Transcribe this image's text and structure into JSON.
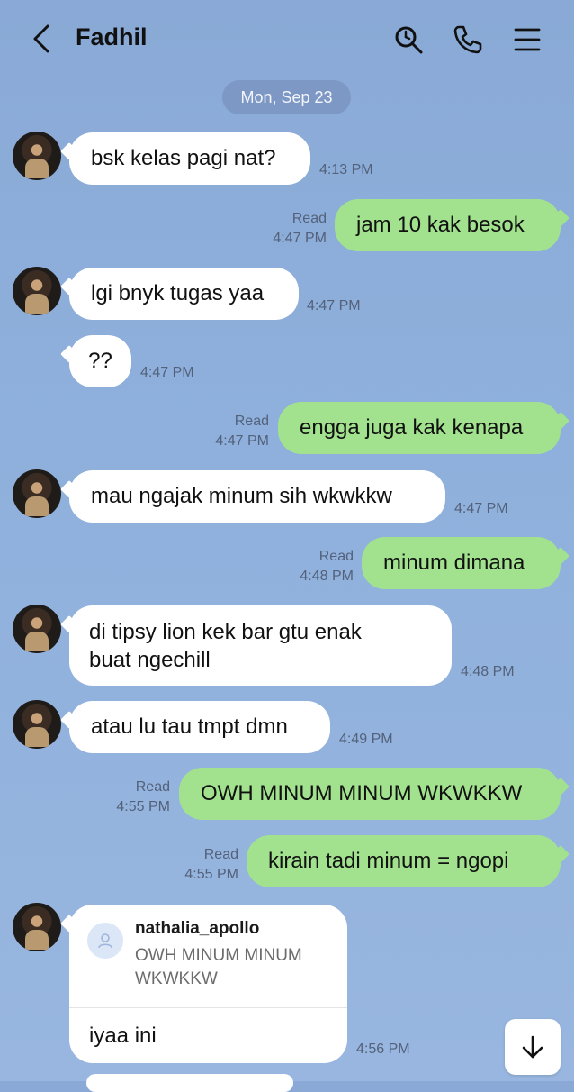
{
  "header": {
    "contact_name": "Fadhil",
    "icons": [
      "back-chevron-icon",
      "search-icon",
      "phone-icon",
      "menu-icon"
    ]
  },
  "date_separator": "Mon, Sep 23",
  "messages": [
    {
      "dir": "in",
      "text": "bsk kelas pagi nat?",
      "time": "4:13 PM"
    },
    {
      "dir": "out",
      "text": "jam 10 kak besok",
      "read": "Read",
      "time": "4:47 PM"
    },
    {
      "dir": "in",
      "text": "lgi bnyk tugas yaa",
      "time": "4:47 PM"
    },
    {
      "dir": "in",
      "text": "??",
      "time": "4:47 PM"
    },
    {
      "dir": "out",
      "text": "engga juga kak kenapa",
      "read": "Read",
      "time": "4:47 PM"
    },
    {
      "dir": "in",
      "text": "mau ngajak minum sih wkwkkw",
      "time": "4:47 PM"
    },
    {
      "dir": "out",
      "text": "minum dimana",
      "read": "Read",
      "time": "4:48 PM"
    },
    {
      "dir": "in",
      "text_line1": "di tipsy lion kek bar gtu enak",
      "text_line2": "buat ngechill",
      "time": "4:48 PM"
    },
    {
      "dir": "in",
      "text": "atau lu tau tmpt dmn",
      "time": "4:49 PM"
    },
    {
      "dir": "out",
      "text": "OWH MINUM MINUM WKWKKW",
      "read": "Read",
      "time": "4:55 PM"
    },
    {
      "dir": "out",
      "text": "kirain tadi minum = ngopi",
      "read": "Read",
      "time": "4:55 PM"
    }
  ],
  "reply_message": {
    "quoted_user": "nathalia_apollo",
    "quoted_text": "OWH MINUM MINUM WKWKKW",
    "reply_text": "iyaa ini",
    "time": "4:56 PM"
  },
  "colors": {
    "background": "#8fb0dc",
    "incoming_bubble": "#ffffff",
    "outgoing_bubble": "#a2e28e",
    "meta_text": "#53617a"
  }
}
